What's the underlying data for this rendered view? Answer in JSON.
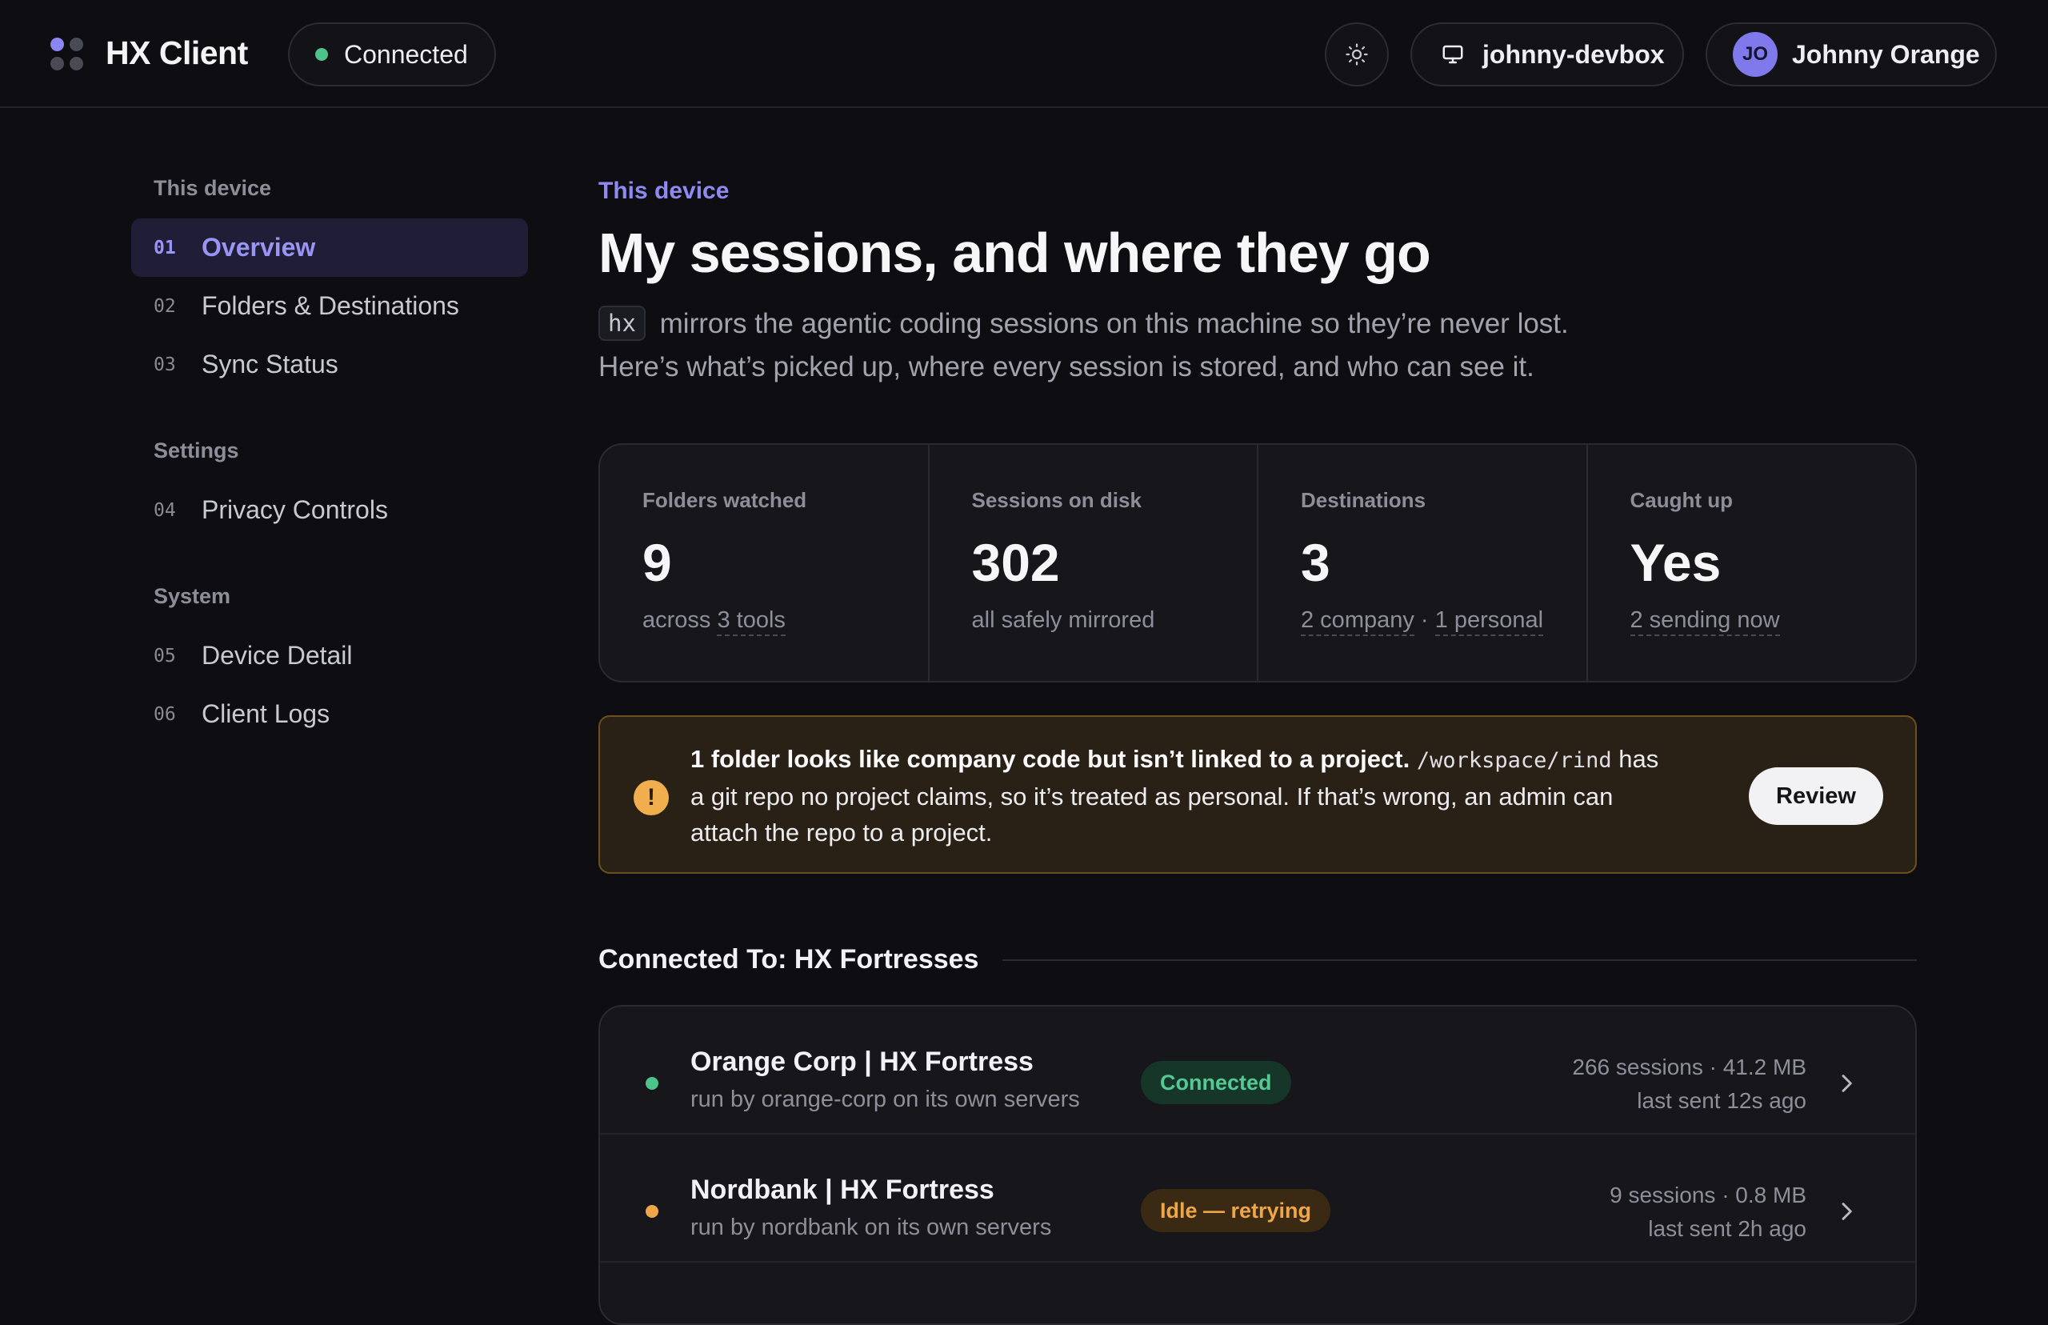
{
  "app": {
    "title": "HX Client"
  },
  "header": {
    "connection_status": "Connected",
    "device_name": "johnny-devbox",
    "user_initials": "JO",
    "user_name": "Johnny Orange"
  },
  "sidebar": {
    "sections": [
      {
        "title": "This device",
        "items": [
          {
            "num": "01",
            "label": "Overview",
            "active": true
          },
          {
            "num": "02",
            "label": "Folders & Destinations"
          },
          {
            "num": "03",
            "label": "Sync Status"
          }
        ]
      },
      {
        "title": "Settings",
        "items": [
          {
            "num": "04",
            "label": "Privacy Controls"
          }
        ]
      },
      {
        "title": "System",
        "items": [
          {
            "num": "05",
            "label": "Device Detail"
          },
          {
            "num": "06",
            "label": "Client Logs"
          }
        ]
      }
    ]
  },
  "main": {
    "eyebrow": "This device",
    "title": "My sessions, and where they go",
    "intro_code": "hx",
    "intro_line1": "mirrors the agentic coding sessions on this machine so they’re never lost.",
    "intro_line2": "Here’s what’s picked up, where every session is stored, and who can see it.",
    "stats": [
      {
        "label": "Folders watched",
        "value": "9",
        "sub_pre": "across ",
        "sub_link": "3 tools"
      },
      {
        "label": "Sessions on disk",
        "value": "302",
        "sub_plain": "all safely mirrored"
      },
      {
        "label": "Destinations",
        "value": "3",
        "sub_link": "2 company",
        "sub_sep": " · ",
        "sub_link2": "1 personal"
      },
      {
        "label": "Caught up",
        "value": "Yes",
        "sub_link": "2 sending now"
      }
    ],
    "warning": {
      "icon": "!",
      "bold": "1 folder looks like company code but isn’t linked to a project.",
      "path": "/workspace/rind",
      "rest": "has a git repo no project claims, so it’s treated as personal. If that’s wrong, an admin can attach the repo to a project.",
      "button": "Review"
    },
    "destinations_title": "Connected To: HX Fortresses",
    "destinations": [
      {
        "name": "Orange Corp | HX Fortress",
        "sub": "run by orange-corp on its own servers",
        "status": "Connected",
        "status_kind": "ok",
        "dot_color": "#4cc38a",
        "meta1": "266 sessions · 41.2 MB",
        "meta2": "last sent 12s ago"
      },
      {
        "name": "Nordbank | HX Fortress",
        "sub": "run by nordbank on its own servers",
        "status": "Idle — retrying",
        "status_kind": "warn",
        "dot_color": "#efa648",
        "meta1": "9 sessions · 0.8 MB",
        "meta2": "last sent 2h ago"
      }
    ]
  }
}
